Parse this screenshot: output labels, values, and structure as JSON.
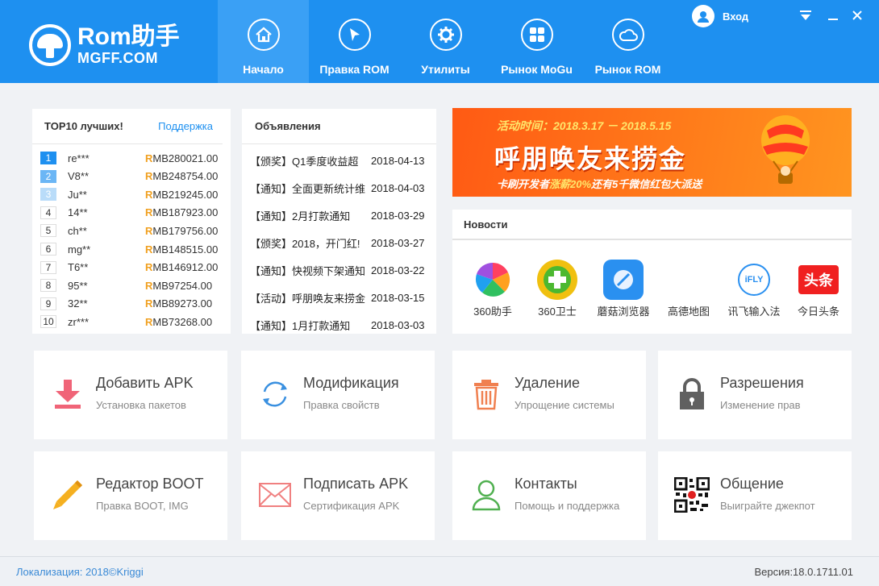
{
  "app": {
    "logo_line1": "Rom助手",
    "logo_line2": "MGFF.COM"
  },
  "nav": [
    {
      "label": "Начало",
      "icon": "home-icon",
      "active": true
    },
    {
      "label": "Правка ROM",
      "icon": "cursor-icon",
      "active": false
    },
    {
      "label": "Утилиты",
      "icon": "gear-icon",
      "active": false
    },
    {
      "label": "Рынок MoGu",
      "icon": "grid-icon",
      "active": false
    },
    {
      "label": "Рынок ROM",
      "icon": "cloud-icon",
      "active": false
    }
  ],
  "header": {
    "login_label": "Вход"
  },
  "top10": {
    "title": "TOP10 лучших!",
    "link": "Поддержка",
    "rows": [
      {
        "rank": "1",
        "name": "re***",
        "amount_prefix": "R",
        "amount": "MB280021.00"
      },
      {
        "rank": "2",
        "name": "V8**",
        "amount_prefix": "R",
        "amount": "MB248754.00"
      },
      {
        "rank": "3",
        "name": "Ju**",
        "amount_prefix": "R",
        "amount": "MB219245.00"
      },
      {
        "rank": "4",
        "name": "14**",
        "amount_prefix": "R",
        "amount": "MB187923.00"
      },
      {
        "rank": "5",
        "name": "ch**",
        "amount_prefix": "R",
        "amount": "MB179756.00"
      },
      {
        "rank": "6",
        "name": "mg**",
        "amount_prefix": "R",
        "amount": "MB148515.00"
      },
      {
        "rank": "7",
        "name": "T6**",
        "amount_prefix": "R",
        "amount": "MB146912.00"
      },
      {
        "rank": "8",
        "name": "95**",
        "amount_prefix": "R",
        "amount": "MB97254.00"
      },
      {
        "rank": "9",
        "name": "32**",
        "amount_prefix": "R",
        "amount": "MB89273.00"
      },
      {
        "rank": "10",
        "name": "zr***",
        "amount_prefix": "R",
        "amount": "MB73268.00"
      }
    ]
  },
  "notices": {
    "title": "Объявления",
    "rows": [
      {
        "text": "【颁奖】Q1季度收益超",
        "date": "2018-04-13"
      },
      {
        "text": "【通知】全面更新统计维",
        "date": "2018-04-03"
      },
      {
        "text": "【通知】2月打款通知",
        "date": "2018-03-29"
      },
      {
        "text": "【颁奖】2018，开门红!",
        "date": "2018-03-27"
      },
      {
        "text": "【通知】快视频下架通知",
        "date": "2018-03-22"
      },
      {
        "text": "【活动】呼朋唤友来捞金",
        "date": "2018-03-15"
      },
      {
        "text": "【通知】1月打款通知",
        "date": "2018-03-03"
      }
    ]
  },
  "banner": {
    "line1": "活动时间：2018.3.17 － 2018.5.15",
    "line2": "呼朋唤友来捞金",
    "line3_a": "卡刷开发者",
    "line3_b": "涨薪20%",
    "line3_c": "还有5千微信红包大派送"
  },
  "news": {
    "title": "Новости",
    "apps": [
      {
        "label": "360助手",
        "icon": "360-assistant-icon"
      },
      {
        "label": "360卫士",
        "icon": "360-security-icon"
      },
      {
        "label": "蘑菇浏览器",
        "icon": "mogu-browser-icon"
      },
      {
        "label": "高德地图",
        "icon": "amap-icon"
      },
      {
        "label": "讯飞输入法",
        "icon": "ifly-icon"
      },
      {
        "label": "今日头条",
        "icon": "toutiao-icon"
      }
    ],
    "ifly_text": "iFLY",
    "toutiao_text": "头条"
  },
  "tools": [
    {
      "title": "Добавить APK",
      "sub": "Установка пакетов",
      "icon": "download-arrow-icon"
    },
    {
      "title": "Модификация",
      "sub": "Правка свойств",
      "icon": "refresh-icon"
    },
    {
      "title": "Удаление",
      "sub": "Упрощение системы",
      "icon": "trash-icon"
    },
    {
      "title": "Разрешения",
      "sub": "Изменение прав",
      "icon": "lock-icon"
    },
    {
      "title": "Редактор BOOT",
      "sub": "Правка BOOT, IMG",
      "icon": "pencil-icon"
    },
    {
      "title": "Подписать APK",
      "sub": "Сертификация APK",
      "icon": "envelope-icon"
    },
    {
      "title": "Контакты",
      "sub": "Помощь и поддержка",
      "icon": "user-icon"
    },
    {
      "title": "Общение",
      "sub": "Выиграйте джекпот",
      "icon": "qr-code-icon"
    }
  ],
  "status": {
    "left": "Локализация: 2018©Kriggi",
    "right": "Версия:18.0.1711.01"
  },
  "colors": {
    "brand": "#1e90f0",
    "active_nav": "#3aa0f5",
    "amount_prefix": "#f0a020",
    "banner": "#ff6a18"
  }
}
